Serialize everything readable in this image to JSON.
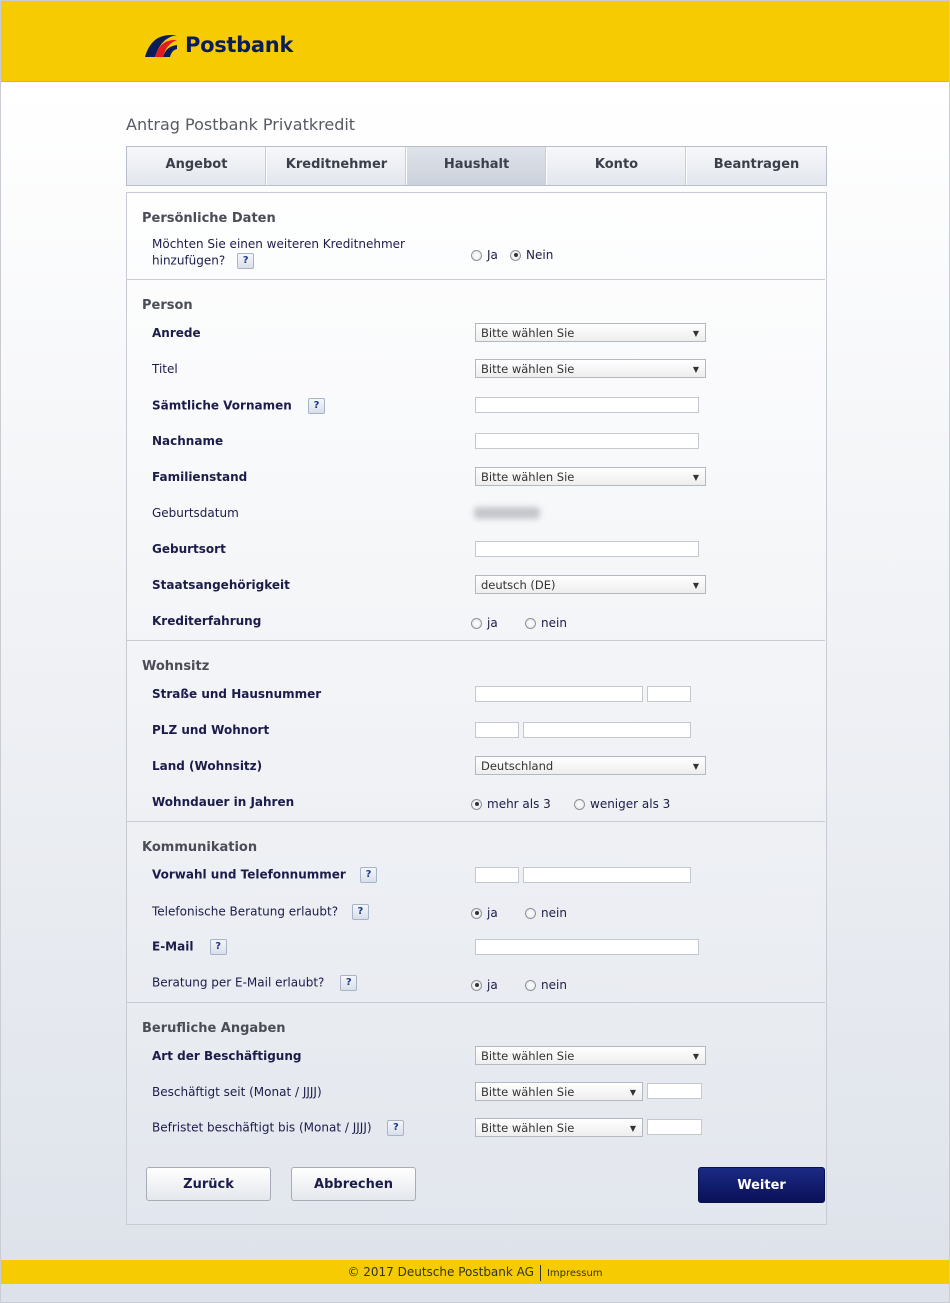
{
  "brand": {
    "name": "Postbank"
  },
  "page_title": "Antrag Postbank Privatkredit",
  "tabs": [
    {
      "label": "Angebot"
    },
    {
      "label": "Kreditnehmer"
    },
    {
      "label": "Haushalt"
    },
    {
      "label": "Konto"
    },
    {
      "label": "Beantragen"
    }
  ],
  "help_glyph": "?",
  "select_placeholder": "Bitte wählen Sie",
  "persoenlich": {
    "title": "Persönliche Daten",
    "question_line1": "Möchten Sie einen weiteren Kreditnehmer",
    "question_line2": "hinzufügen?",
    "options": [
      "Ja",
      "Nein"
    ],
    "selected": "Nein"
  },
  "person": {
    "title": "Person",
    "anrede": "Anrede",
    "titel": "Titel",
    "vornamen": "Sämtliche Vornamen",
    "nachname": "Nachname",
    "familienstand": "Familienstand",
    "geburtsdatum": "Geburtsdatum",
    "geburtsort": "Geburtsort",
    "staatsangehoerigkeit": "Staatsangehörigkeit",
    "staatsangehoerigkeit_value": "deutsch (DE)",
    "krediterfahrung": "Krediterfahrung",
    "krediterfahrung_options": [
      "ja",
      "nein"
    ]
  },
  "wohnsitz": {
    "title": "Wohnsitz",
    "strasse": "Straße und Hausnummer",
    "plz": "PLZ und Wohnort",
    "land": "Land (Wohnsitz)",
    "land_value": "Deutschland",
    "wohndauer": "Wohndauer in Jahren",
    "wohndauer_options": [
      "mehr als 3",
      "weniger als 3"
    ],
    "wohndauer_selected": "mehr als 3"
  },
  "kommunikation": {
    "title": "Kommunikation",
    "telefon": "Vorwahl und Telefonnummer",
    "beratung_tel": "Telefonische Beratung erlaubt?",
    "email": "E-Mail",
    "beratung_email": "Beratung per E-Mail erlaubt?",
    "options": [
      "ja",
      "nein"
    ],
    "beratung_tel_selected": "ja",
    "beratung_email_selected": "ja"
  },
  "beruf": {
    "title": "Berufliche Angaben",
    "art": "Art der Beschäftigung",
    "seit": "Beschäftigt seit (Monat / JJJJ)",
    "befristet": "Befristet beschäftigt bis (Monat / JJJJ)"
  },
  "buttons": {
    "back": "Zurück",
    "cancel": "Abbrechen",
    "next": "Weiter"
  },
  "footer": {
    "copyright": "© 2017 Deutsche Postbank AG",
    "impressum": "Impressum"
  },
  "colors": {
    "brand_yellow": "#f7cb02",
    "brand_navy": "#0b1d59",
    "primary_button": "#0a1158"
  }
}
